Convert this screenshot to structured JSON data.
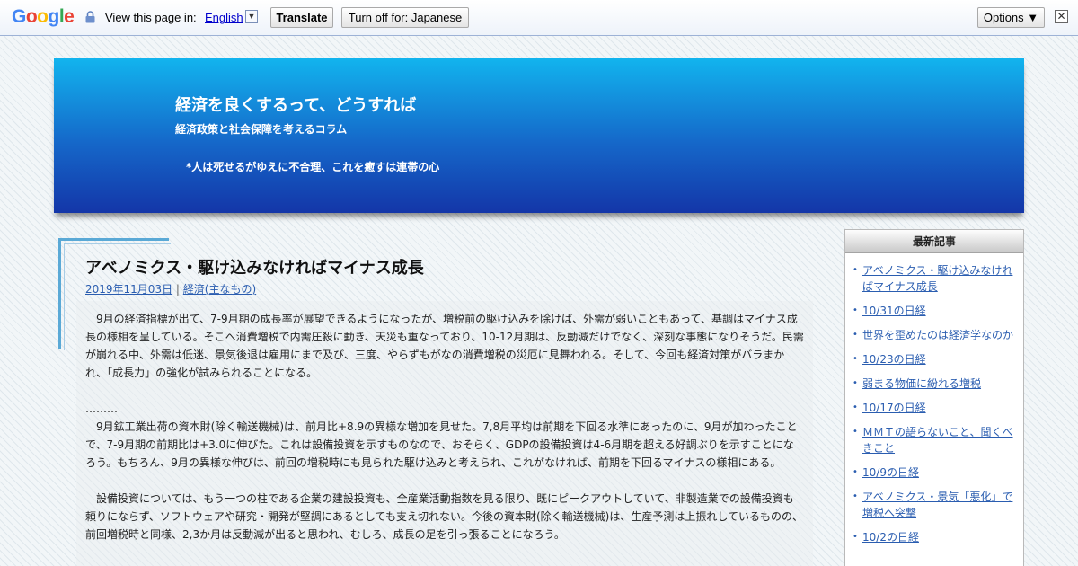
{
  "translate_bar": {
    "logo_text": "Google",
    "view_label": "View this page in:",
    "language": "English",
    "dropdown_glyph": "▼",
    "translate_label": "Translate",
    "turn_off_label": "Turn off for: Japanese",
    "options_label": "Options ▼",
    "close_glyph": "✕"
  },
  "header": {
    "title": "経済を良くするって、どうすれば",
    "description": "経済政策と社会保障を考えるコラム",
    "tagline": "*人は死せるがゆえに不合理、これを癒すは連帯の心"
  },
  "post": {
    "title": "アベノミクス・駆け込みなければマイナス成長",
    "date": "2019年11月03日",
    "separator": "|",
    "category": "経済(主なもの)",
    "paragraphs": [
      "9月の経済指標が出て、7-9月期の成長率が展望できるようになったが、増税前の駆け込みを除けば、外需が弱いこともあって、基調はマイナス成長の様相を呈している。そこへ消費増税で内需圧殺に動き、天災も重なっており、10-12月期は、反動減だけでなく、深刻な事態になりそうだ。民需が崩れる中、外需は低迷、景気後退は雇用にまで及び、三度、やらずもがなの消費増税の災厄に見舞われる。そして、今回も経済対策がバラまかれ、「成長力」の強化が試みられることになる。",
      "………",
      "9月鉱工業出荷の資本財(除く輸送機械)は、前月比+8.9の異様な増加を見せた。7,8月平均は前期を下回る水準にあったのに、9月が加わったことで、7-9月期の前期比は+3.0に伸びた。これは設備投資を示すものなので、おそらく、GDPの設備投資は4-6月期を超える好調ぶりを示すことになろう。もちろん、9月の異様な伸びは、前回の増税時にも見られた駆け込みと考えられ、これがなければ、前期を下回るマイナスの様相にある。",
      "設備投資については、もう一つの柱である企業の建設投資も、全産業活動指数を見る限り、既にピークアウトしていて、非製造業での設備投資も頼りにならず、ソフトウェアや研究・開発が堅調にあるとしても支え切れない。今後の資本財(除く輸送機械)は、生産予測は上振れしているものの、前回増税時と同様、2,3か月は反動減が出ると思われ、むしろ、成長の足を引っ張ることになろう。"
    ]
  },
  "sidebar": {
    "heading": "最新記事",
    "items": [
      "アベノミクス・駆け込みなければマイナス成長",
      "10/31の日経",
      "世界を歪めたのは経済学なのか",
      "10/23の日経",
      "弱まる物価に紛れる増税",
      "10/17の日経",
      "ＭＭＴの語らないこと、聞くべきこと",
      "10/9の日経",
      "アベノミクス・景気「悪化」で増税へ突撃",
      "10/2の日経"
    ]
  },
  "colors": {
    "header_top": "#12b4ee",
    "header_bottom": "#1436a8",
    "link": "#2a5db0"
  }
}
